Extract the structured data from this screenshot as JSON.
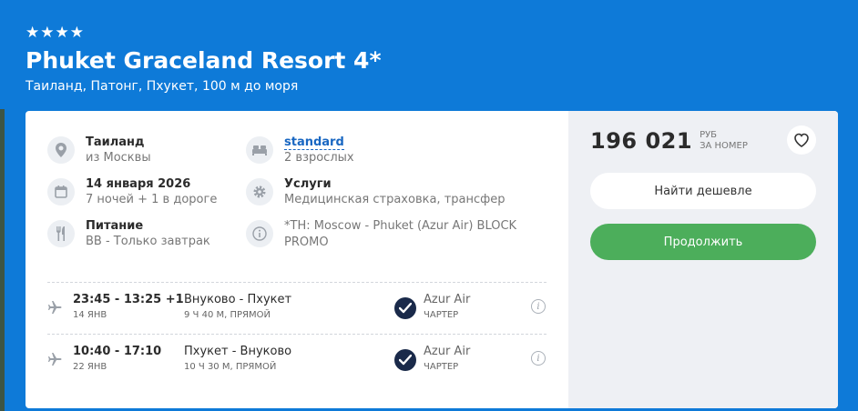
{
  "hotel": {
    "stars": "★★★★",
    "title": "Phuket Graceland Resort 4*",
    "location": "Таиланд, Патонг, Пхукет, 100 м до моря"
  },
  "info": {
    "country": {
      "icon": "location-pin-icon",
      "title": "Таиланд",
      "sub": "из Москвы"
    },
    "room": {
      "icon": "bed-icon",
      "title": "standard",
      "sub": "2 взрослых"
    },
    "dates": {
      "icon": "calendar-icon",
      "title": "14 января 2026",
      "sub": "7 ночей + 1 в дороге"
    },
    "services": {
      "icon": "gear-icon",
      "title": "Услуги",
      "sub": "Медицинская страховка, трансфер"
    },
    "meal": {
      "icon": "fork-knife-icon",
      "title": "Питание",
      "sub": "BB - Только завтрак"
    },
    "note": {
      "icon": "info-icon",
      "line1": "*TH: Moscow - Phuket (Azur Air) BLOCK",
      "line2": "PROMO"
    }
  },
  "flights": [
    {
      "time": "23:45 - 13:25 +1",
      "date": "14 ЯНВ",
      "route": "Внуково - Пхукет",
      "duration": "9 Ч 40 М, ПРЯМОЙ",
      "airline": "Azur Air",
      "type": "ЧАРТЕР"
    },
    {
      "time": "10:40 - 17:10",
      "date": "22 ЯНВ",
      "route": "Пхукет - Внуково",
      "duration": "10 Ч 30 М, ПРЯМОЙ",
      "airline": "Azur Air",
      "type": "ЧАРТЕР"
    }
  ],
  "pricing": {
    "amount": "196 021",
    "currency": "РУБ",
    "per": "ЗА НОМЕР",
    "cheaper_label": "Найти дешевле",
    "continue_label": "Продолжить"
  },
  "colors": {
    "header_bg": "#0e7ad8",
    "accent_link": "#1967c2",
    "continue_button": "#4cae5b",
    "price_panel_bg": "#eef0f4"
  }
}
